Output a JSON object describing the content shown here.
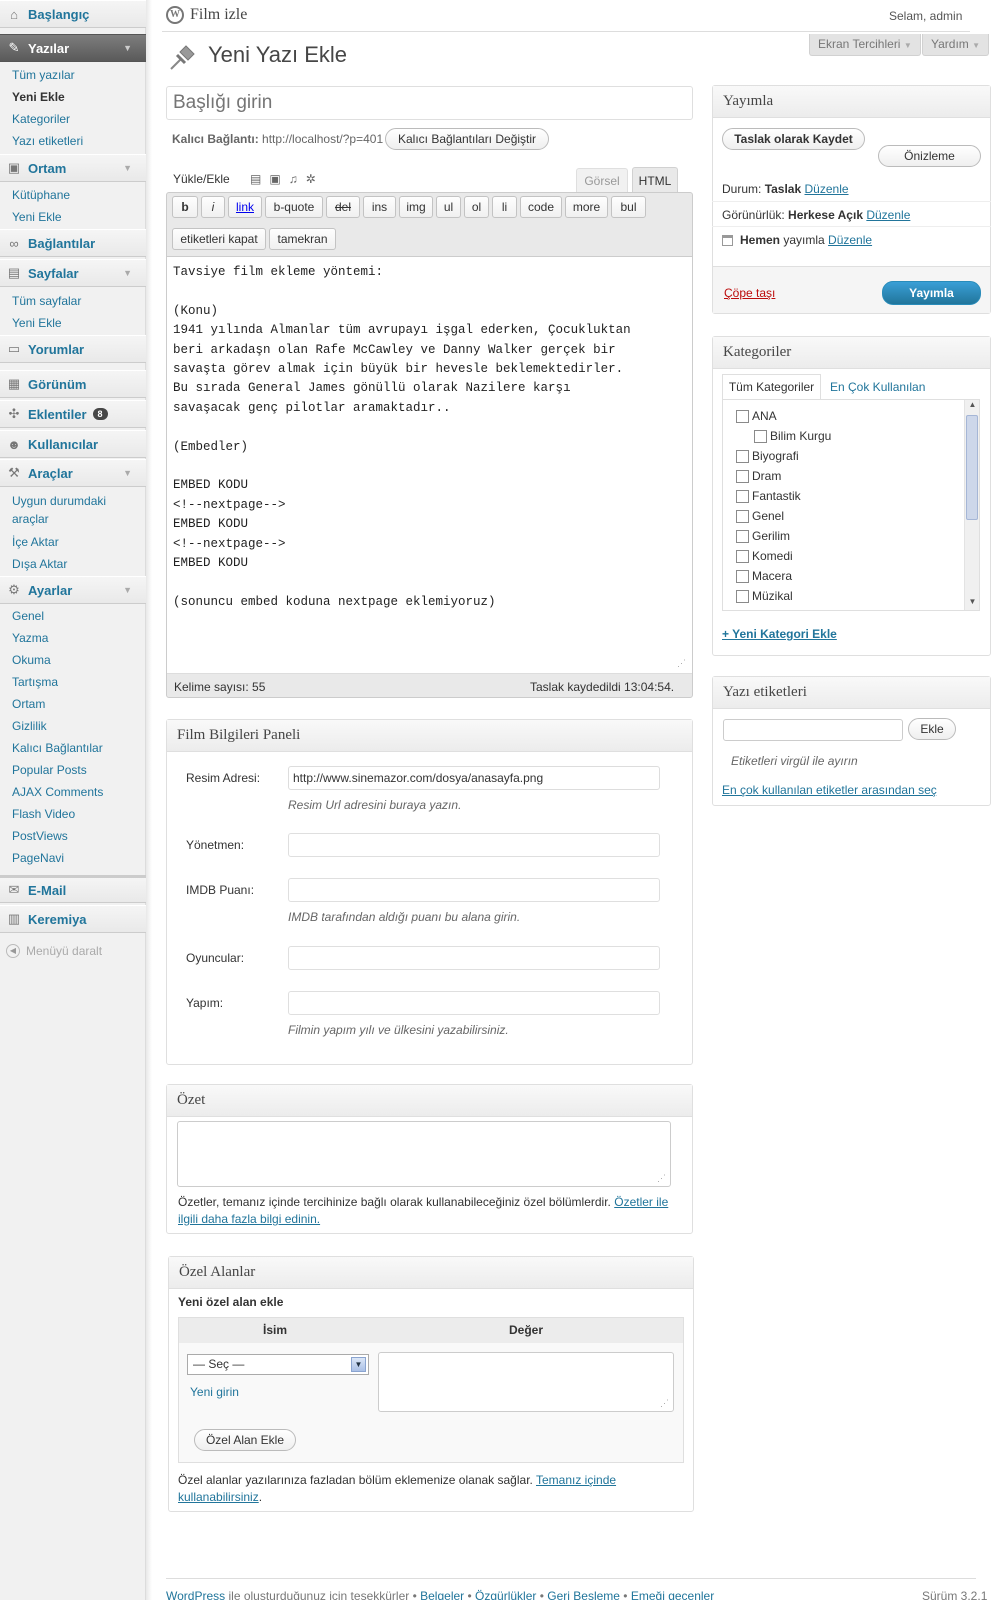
{
  "site": {
    "title": "Film izle",
    "greeting": "Selam, admin"
  },
  "header": {
    "screen_options": "Ekran Tercihleri",
    "help": "Yardım",
    "page_title": "Yeni Yazı Ekle"
  },
  "menu": {
    "dashboard": "Başlangıç",
    "posts": "Yazılar",
    "posts_sub": [
      "Tüm yazılar",
      "Yeni Ekle",
      "Kategoriler",
      "Yazı etiketleri"
    ],
    "media": "Ortam",
    "media_sub": [
      "Kütüphane",
      "Yeni Ekle"
    ],
    "links": "Bağlantılar",
    "pages": "Sayfalar",
    "pages_sub": [
      "Tüm sayfalar",
      "Yeni Ekle"
    ],
    "comments": "Yorumlar",
    "appearance": "Görünüm",
    "plugins": "Eklentiler",
    "plugins_badge": "8",
    "users": "Kullanıcılar",
    "tools": "Araçlar",
    "tools_sub": [
      "Uygun durumdaki",
      "araçlar",
      "İçe Aktar",
      "Dışa Aktar"
    ],
    "settings": "Ayarlar",
    "settings_sub": [
      "Genel",
      "Yazma",
      "Okuma",
      "Tartışma",
      "Ortam",
      "Gizlilik",
      "Kalıcı Bağlantılar",
      "Popular Posts",
      "AJAX Comments",
      "Flash Video",
      "PostViews",
      "PageNavi"
    ],
    "email": "E-Mail",
    "keremiya": "Keremiya",
    "collapse": "Menüyü daralt"
  },
  "editor": {
    "title_placeholder": "Başlığı girin",
    "permalink_label": "Kalıcı Bağlantı:",
    "permalink_url": "http://localhost/?p=401",
    "permalink_button": "Kalıcı Bağlantıları Değiştir",
    "upload_label": "Yükle/Ekle",
    "tab_visual": "Görsel",
    "tab_html": "HTML",
    "quicktags": [
      "b",
      "i",
      "link",
      "b-quote",
      "del",
      "ins",
      "img",
      "ul",
      "ol",
      "li",
      "code",
      "more",
      "bul"
    ],
    "quicktags2": [
      "etiketleri kapat",
      "tamekran"
    ],
    "content": "Tavsiye film ekleme yöntemi:\n\n(Konu)\n1941 yılında Almanlar tüm avrupayı işgal ederken, Çocukluktan\nberi arkadaşn olan Rafe McCawley ve Danny Walker gerçek bir\nsavaşta görev almak için büyük bir hevesle beklemektedirler.\nBu sırada General James gönüllü olarak Nazilere karşı\nsavaşacak genç pilotlar aramaktadır..\n\n(Embedler)\n\nEMBED KODU\n<!--nextpage-->\nEMBED KODU\n<!--nextpage-->\nEMBED KODU\n\n(sonuncu embed koduna nextpage eklemiyoruz)",
    "word_count": "Kelime sayısı: 55",
    "draft_saved": "Taslak kaydedildi 13:04:54."
  },
  "film_panel": {
    "title": "Film Bilgileri Paneli",
    "image_label": "Resim Adresi:",
    "image_value": "http://www.sinemazor.com/dosya/anasayfa.png",
    "image_hint": "Resim Url adresini buraya yazın.",
    "director_label": "Yönetmen:",
    "imdb_label": "IMDB Puanı:",
    "imdb_hint": "IMDB tarafından aldığı puanı bu alana girin.",
    "actors_label": "Oyuncular:",
    "production_label": "Yapım:",
    "production_hint": "Filmin yapım yılı ve ülkesini yazabilirsiniz."
  },
  "excerpt": {
    "title": "Özet",
    "help": "Özetler, temanız içinde tercihinize bağlı olarak kullanabileceğiniz özel bölümlerdir.",
    "link1": "Özetler ile",
    "link2": "ilgili daha fazla bilgi edinin."
  },
  "custom_fields": {
    "title": "Özel Alanlar",
    "new_label": "Yeni özel alan ekle",
    "col_name": "İsim",
    "col_value": "Değer",
    "select": "— Seç —",
    "enter_new": "Yeni girin",
    "add_button": "Özel Alan Ekle",
    "help": "Özel alanlar yazılarınıza fazladan bölüm eklemenize olanak sağlar.",
    "link1": "Temanız içinde",
    "link2": "kullanabilirsiniz"
  },
  "publish": {
    "title": "Yayımla",
    "save_draft": "Taslak olarak Kaydet",
    "preview": "Önizleme",
    "status_label": "Durum:",
    "status_value": "Taslak",
    "edit": "Düzenle",
    "visibility_label": "Görünürlük:",
    "visibility_value": "Herkese Açık",
    "schedule_bold": "Hemen",
    "schedule_text": "yayımla",
    "trash": "Çöpe taşı",
    "publish_btn": "Yayımla"
  },
  "categories": {
    "title": "Kategoriler",
    "tab_all": "Tüm Kategoriler",
    "tab_popular": "En Çok Kullanılan",
    "items": [
      "ANA",
      "Bilim Kurgu",
      "Biyografi",
      "Dram",
      "Fantastik",
      "Genel",
      "Gerilim",
      "Komedi",
      "Macera",
      "Müzikal"
    ],
    "add_new": "+ Yeni Kategori Ekle"
  },
  "tags": {
    "title": "Yazı etiketleri",
    "add": "Ekle",
    "hint": "Etiketleri virgül ile ayırın",
    "popular": "En çok kullanılan etiketler arasından seç"
  },
  "footer": {
    "thanks_link": "WordPress",
    "thanks": "ile oluşturduğunuz için teşekkürler",
    "links": [
      "Belgeler",
      "Özgürlükler",
      "Geri Besleme",
      "Emeği geçenler"
    ],
    "version": "Sürüm 3.2.1"
  },
  "colors": {
    "link": "#21759b",
    "publish": "#2a8bbf",
    "trash": "#bc0b0b",
    "active_menu": "#6d6d6d"
  }
}
